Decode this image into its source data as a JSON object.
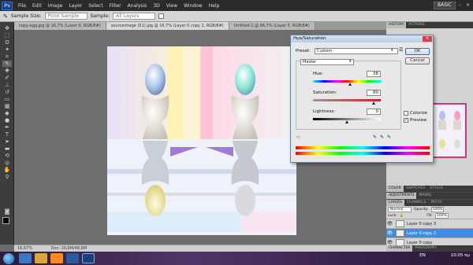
{
  "app": {
    "logo": "Ps",
    "workspace": "BASIC"
  },
  "menu": [
    "File",
    "Edit",
    "Image",
    "Layer",
    "Select",
    "Filter",
    "Analysis",
    "3D",
    "View",
    "Window",
    "Help"
  ],
  "options": {
    "sample_size_label": "Sample Size:",
    "sample_size_value": "Point Sample",
    "sample_label": "Sample:",
    "sample_value": "All Layers"
  },
  "doc_tabs": [
    "copy-egg.jpg @ 16,7% (Layer 0, RGB/8#)",
    "sourceimage (51).jpg @ 16,7% (Layer 0 copy 2, RGB/8#)",
    "Untitled-1 @ 66,7% (Layer 0, RGB/8#)"
  ],
  "status": {
    "zoom": "16,67%",
    "doc": "Doc: 20,6M/48,6M"
  },
  "panels": {
    "history_tabs": [
      "HISTORY",
      "ACTIONS"
    ],
    "color_tabs": [
      "COLOR",
      "SWATCHES",
      "STYLES"
    ],
    "adj_tabs": [
      "ADJUSTMENTS",
      "MASKS"
    ],
    "layers_tabs": [
      "LAYERS",
      "CHANNELS",
      "PATHS"
    ],
    "blend_mode": "Normal",
    "opacity_label": "Opacity:",
    "opacity_value": "100%",
    "lock_label": "Lock:",
    "fill_label": "Fill:",
    "fill_value": "100%",
    "layers": [
      "Layer 0 copy 3",
      "Layer 0 copy 2",
      "Layer 0 copy"
    ],
    "bottom_tabs": [
      "CHARACTER",
      "PARAGRAPH"
    ]
  },
  "dialog": {
    "title": "Hue/Saturation",
    "preset_label": "Preset:",
    "preset_value": "Custom",
    "channel_value": "Master",
    "hue_label": "Hue:",
    "hue_value": "38",
    "saturation_label": "Saturation:",
    "saturation_value": "80",
    "lightness_label": "Lightness:",
    "lightness_value": "0",
    "ok_label": "OK",
    "cancel_label": "Cancel",
    "colorize_label": "Colorize",
    "preview_label": "Preview",
    "hue_position": 0.55,
    "saturation_position": 0.9,
    "lightness_position": 0.5
  },
  "taskbar": {
    "lang": "EN",
    "time": "10:05 πμ"
  }
}
